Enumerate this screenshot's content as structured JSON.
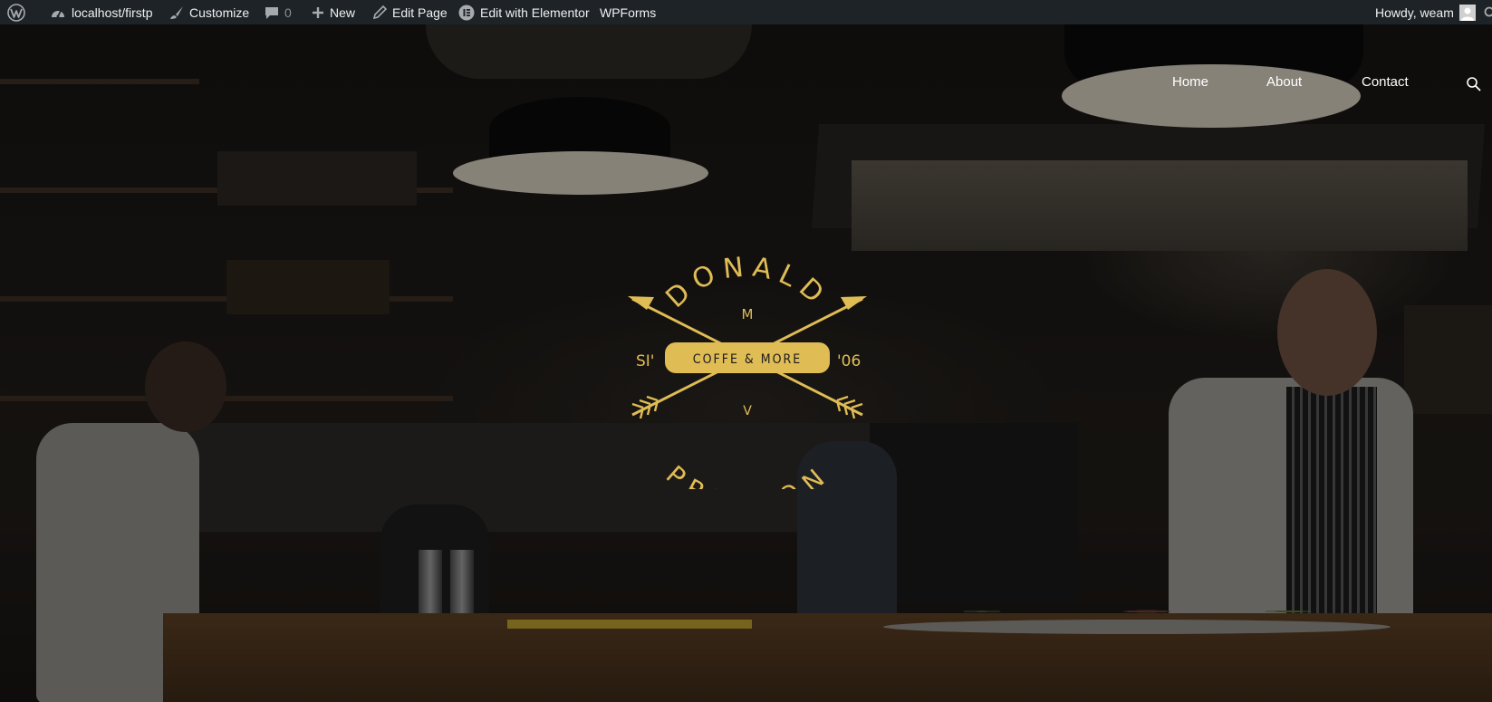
{
  "adminbar": {
    "site_label": "localhost/firstp",
    "customize_label": "Customize",
    "comments_count": "0",
    "new_label": "New",
    "edit_page_label": "Edit Page",
    "elementor_label": "Edit with Elementor",
    "wpforms_label": "WPForms",
    "howdy_label": "Howdy, weam"
  },
  "nav": {
    "items": [
      {
        "label": "Home"
      },
      {
        "label": "About"
      },
      {
        "label": "Contact"
      }
    ]
  },
  "logo": {
    "top_text": "DONALD",
    "bottom_text": "PRESTON",
    "banner_text": "COFFE & MORE",
    "left_text": "SI'",
    "right_text": "'06",
    "upper_letter": "M",
    "lower_letter": "V",
    "color": "#e0bc55"
  },
  "colors": {
    "adminbar_bg": "#1d2327",
    "adminbar_text": "#f0f0f1",
    "nav_text": "#ffffff"
  },
  "icons": {
    "wordpress": "wordpress-icon",
    "dashboard": "dashboard-icon",
    "customize": "brush-icon",
    "comments": "comment-icon",
    "new": "plus-icon",
    "edit": "pencil-icon",
    "elementor": "elementor-icon",
    "search": "search-icon",
    "avatar": "avatar-icon"
  }
}
